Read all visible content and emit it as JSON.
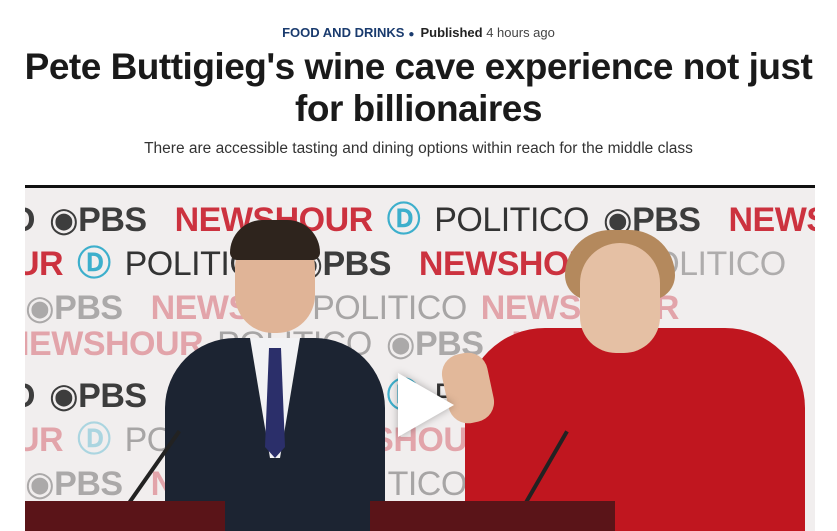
{
  "article": {
    "category": "FOOD AND DRINKS",
    "published_label": "Published",
    "published_time": "4 hours ago",
    "headline": "Pete Buttigieg's wine cave experience not just for billionaires",
    "subheadline": "There are accessible tasting and dining options within reach for the middle class"
  },
  "video": {
    "backdrop_words": {
      "pbs": "PBS",
      "newshour": "NEWSHOUR",
      "politico": "POLITICO",
      "news": "NEWS",
      "co": "CO",
      "ur": "UR"
    },
    "play_icon": "play-icon"
  },
  "colors": {
    "category": "#1a3b6e",
    "newshour_red": "#c81e2d",
    "politico_teal": "#2aa9c9",
    "jacket_red": "#c0161f"
  }
}
